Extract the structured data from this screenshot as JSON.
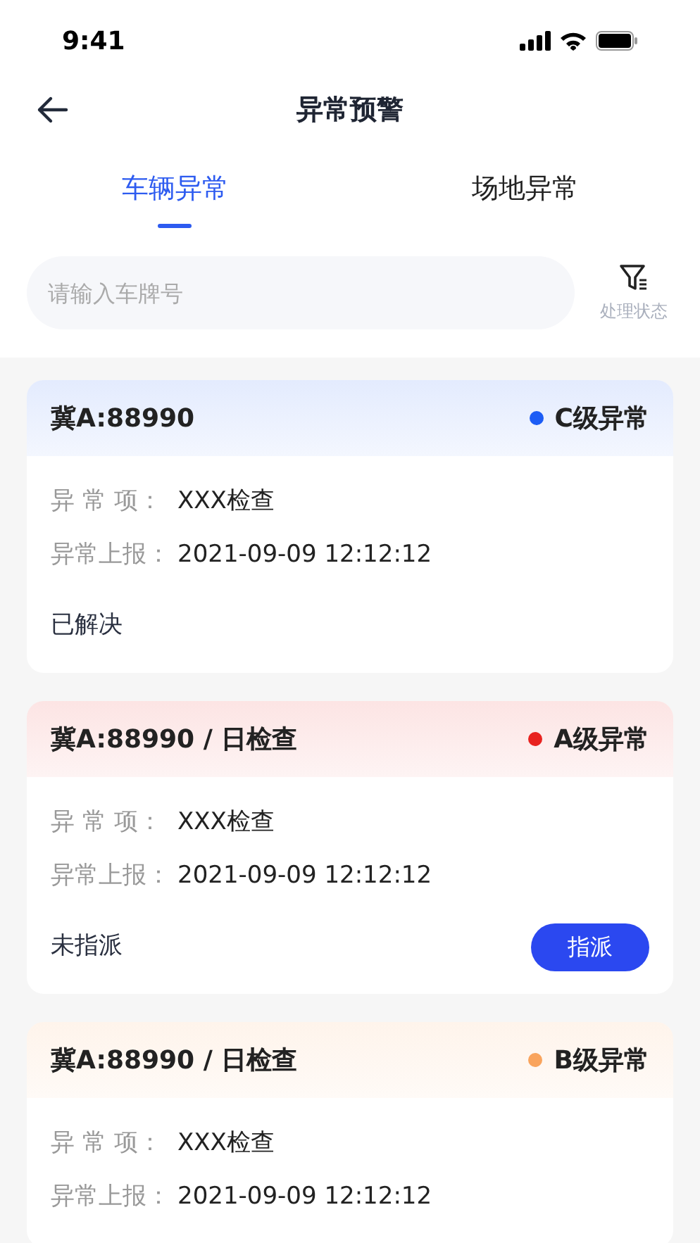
{
  "status_bar": {
    "time": "9:41"
  },
  "nav": {
    "title": "异常预警"
  },
  "tabs": [
    {
      "label": "车辆异常",
      "selected": true
    },
    {
      "label": "场地异常",
      "selected": false
    }
  ],
  "search": {
    "placeholder": "请输入车牌号"
  },
  "filter": {
    "label": "处理状态"
  },
  "cards": [
    {
      "title": "冀A:88990",
      "level": "C级异常",
      "color": "#1c5cf5",
      "fields": [
        {
          "label": "异 常 项：",
          "value": "XXX检查"
        },
        {
          "label": "异常上报：",
          "value": "2021-09-09 12:12:12"
        }
      ],
      "status": "已解决"
    },
    {
      "title": "冀A:88990 / 日检查",
      "level": "A级异常",
      "color": "#e8221f",
      "fields": [
        {
          "label": "异 常 项：",
          "value": "XXX检查"
        },
        {
          "label": "异常上报：",
          "value": "2021-09-09 12:12:12"
        }
      ],
      "status": "未指派",
      "action": "指派"
    },
    {
      "title": "冀A:88990 / 日检查",
      "level": "B级异常",
      "color": "#f9a45d",
      "fields": [
        {
          "label": "异 常 项：",
          "value": "XXX检查"
        },
        {
          "label": "异常上报：",
          "value": "2021-09-09 12:12:12"
        }
      ]
    }
  ]
}
